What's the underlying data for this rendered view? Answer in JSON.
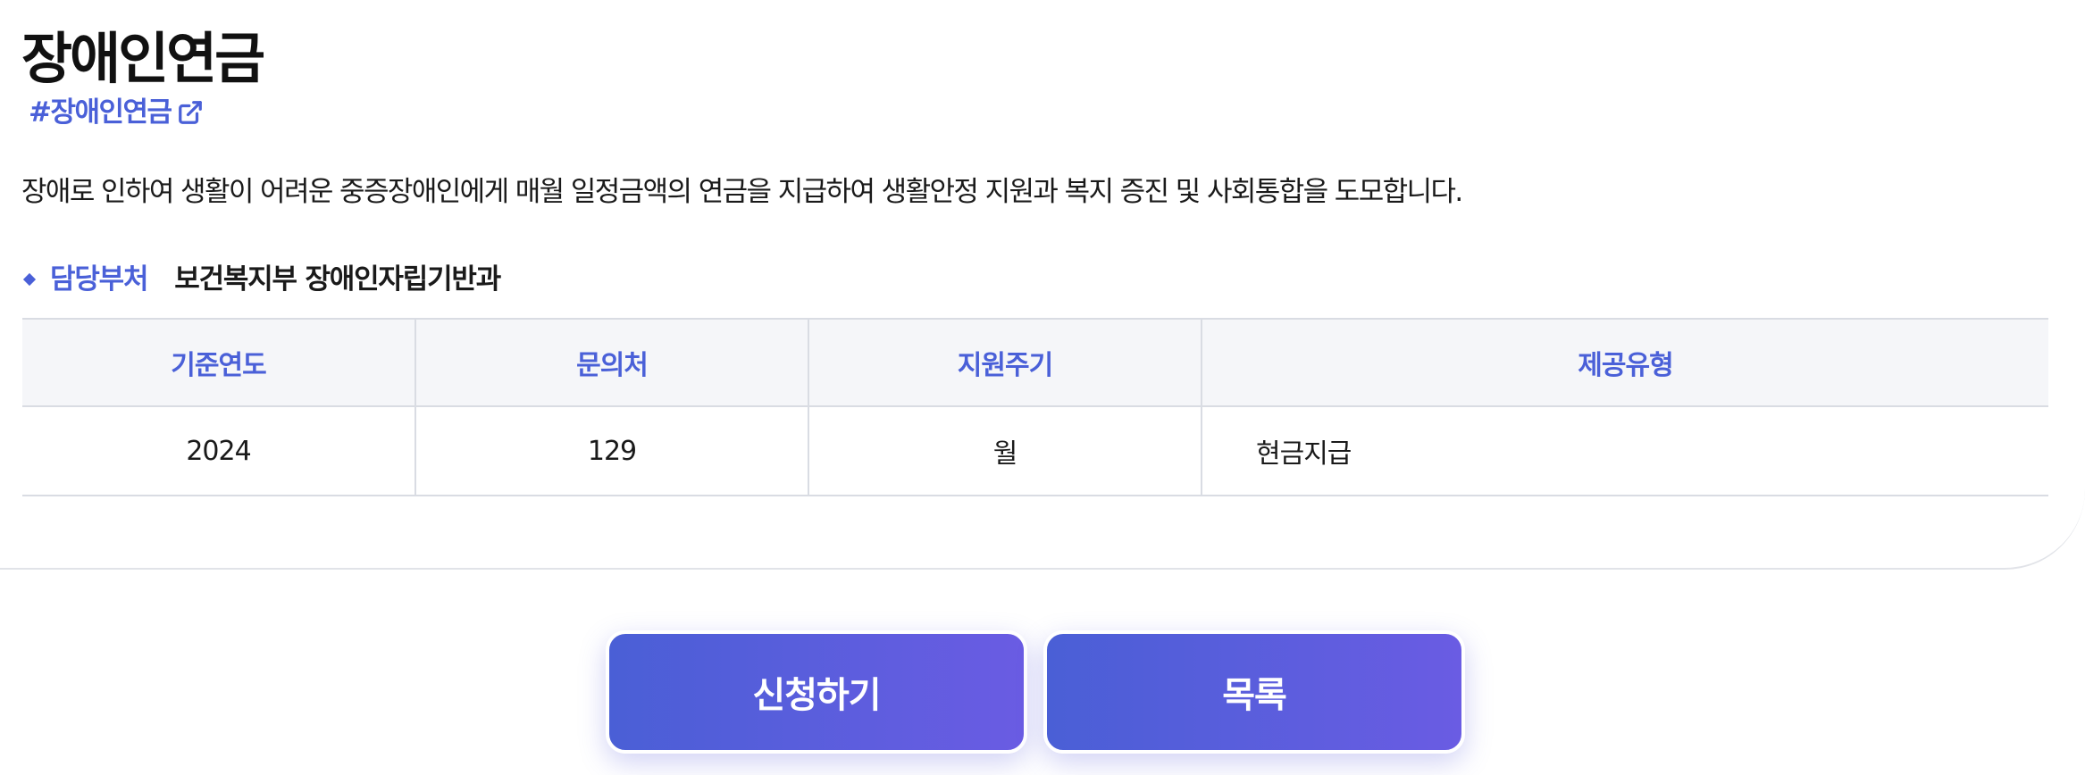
{
  "page": {
    "title": "장애인연금",
    "tag": "#장애인연금",
    "description": "장애로 인하여 생활이 어려운 중증장애인에게 매월 일정금액의 연금을 지급하여 생활안정 지원과 복지 증진 및 사회통합을 도모합니다."
  },
  "department": {
    "label": "담당부처",
    "value": "보건복지부 장애인자립기반과"
  },
  "table": {
    "headers": [
      "기준연도",
      "문의처",
      "지원주기",
      "제공유형"
    ],
    "row": [
      "2024",
      "129",
      "월",
      "현금지급"
    ]
  },
  "buttons": {
    "apply": "신청하기",
    "list": "목록"
  },
  "colors": {
    "accent": "#4a60d8",
    "button_gradient_start": "#4a5fd6",
    "button_gradient_end": "#6a5ce3",
    "header_bg": "#f5f6f9"
  },
  "icons": {
    "tag_link": "external-link-icon",
    "bullet": "diamond-bullet-icon"
  }
}
